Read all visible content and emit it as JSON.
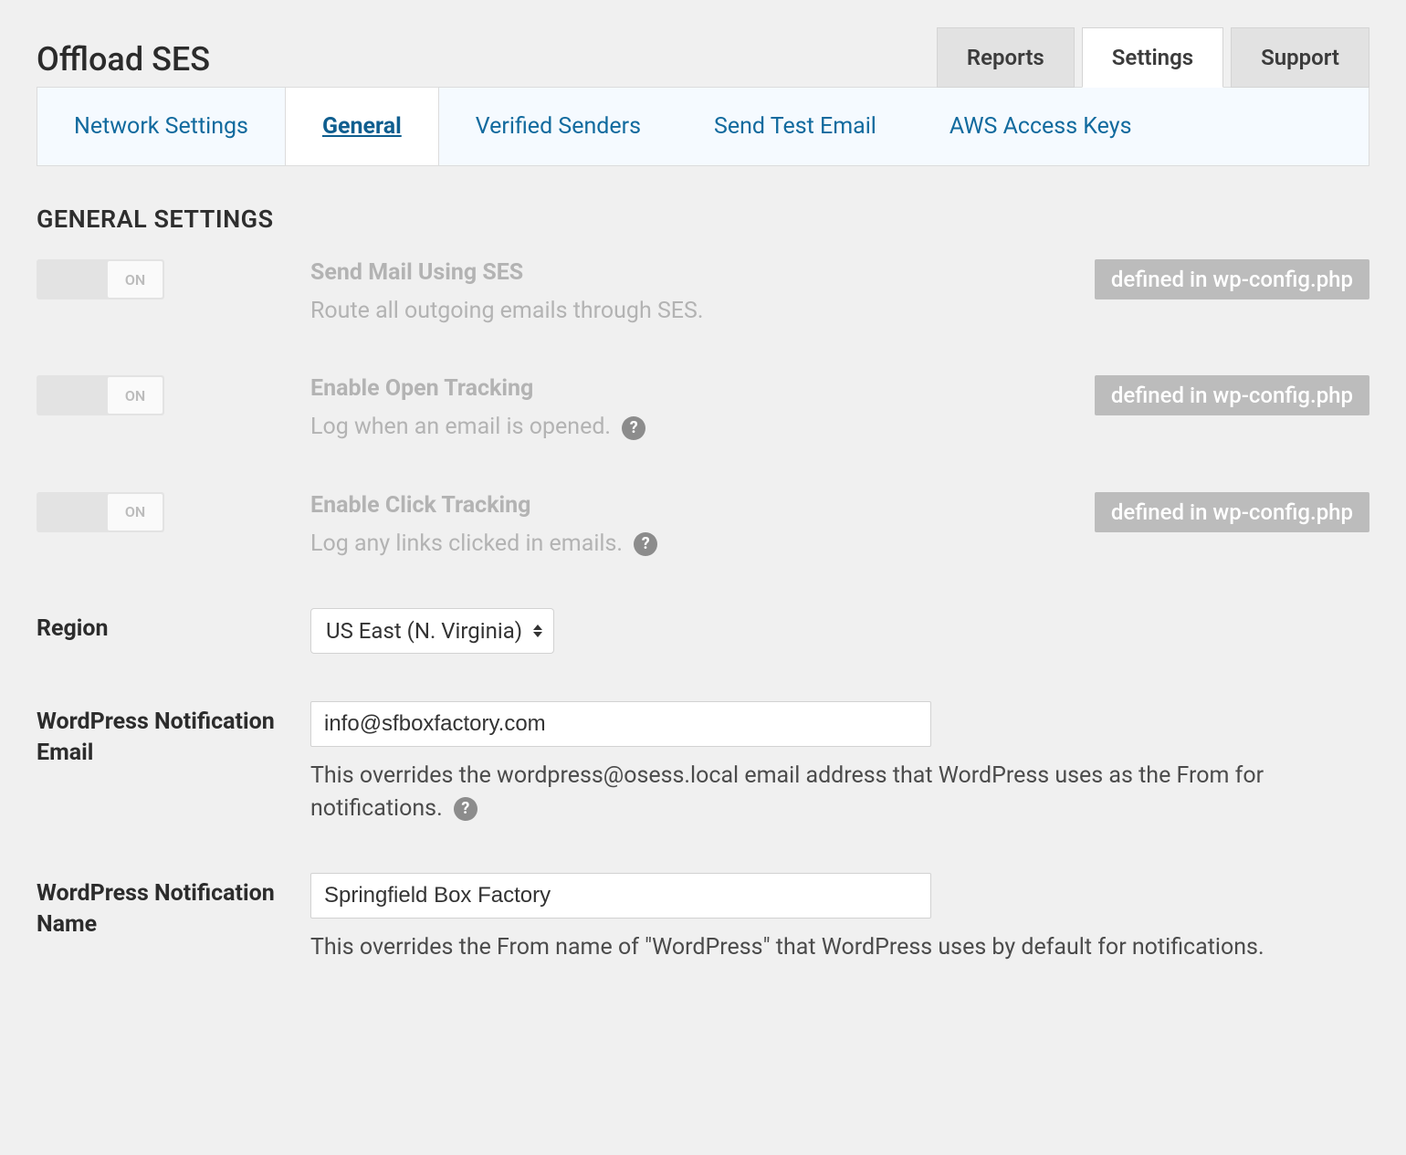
{
  "page_title": "Offload SES",
  "main_tabs": [
    {
      "label": "Reports",
      "active": false
    },
    {
      "label": "Settings",
      "active": true
    },
    {
      "label": "Support",
      "active": false
    }
  ],
  "sub_tabs": [
    {
      "label": "Network Settings",
      "active": false
    },
    {
      "label": "General",
      "active": true
    },
    {
      "label": "Verified Senders",
      "active": false
    },
    {
      "label": "Send Test Email",
      "active": false
    },
    {
      "label": "AWS Access Keys",
      "active": false
    }
  ],
  "section_title": "GENERAL SETTINGS",
  "defined_badge": "defined in wp-config.php",
  "toggle_on_label": "ON",
  "settings_toggles": [
    {
      "title": "Send Mail Using SES",
      "desc": "Route all outgoing emails through SES.",
      "help": false
    },
    {
      "title": "Enable Open Tracking",
      "desc": "Log when an email is opened.",
      "help": true
    },
    {
      "title": "Enable Click Tracking",
      "desc": "Log any links clicked in emails.",
      "help": true
    }
  ],
  "region": {
    "label": "Region",
    "value": "US East (N. Virginia)"
  },
  "notification_email": {
    "label": "WordPress Notification Email",
    "value": "info@sfboxfactory.com",
    "help": "This overrides the wordpress@osess.local email address that WordPress uses as the From for notifications."
  },
  "notification_name": {
    "label": "WordPress Notification Name",
    "value": "Springfield Box Factory",
    "help": "This overrides the From name of \"WordPress\" that WordPress uses by default for notifications."
  }
}
